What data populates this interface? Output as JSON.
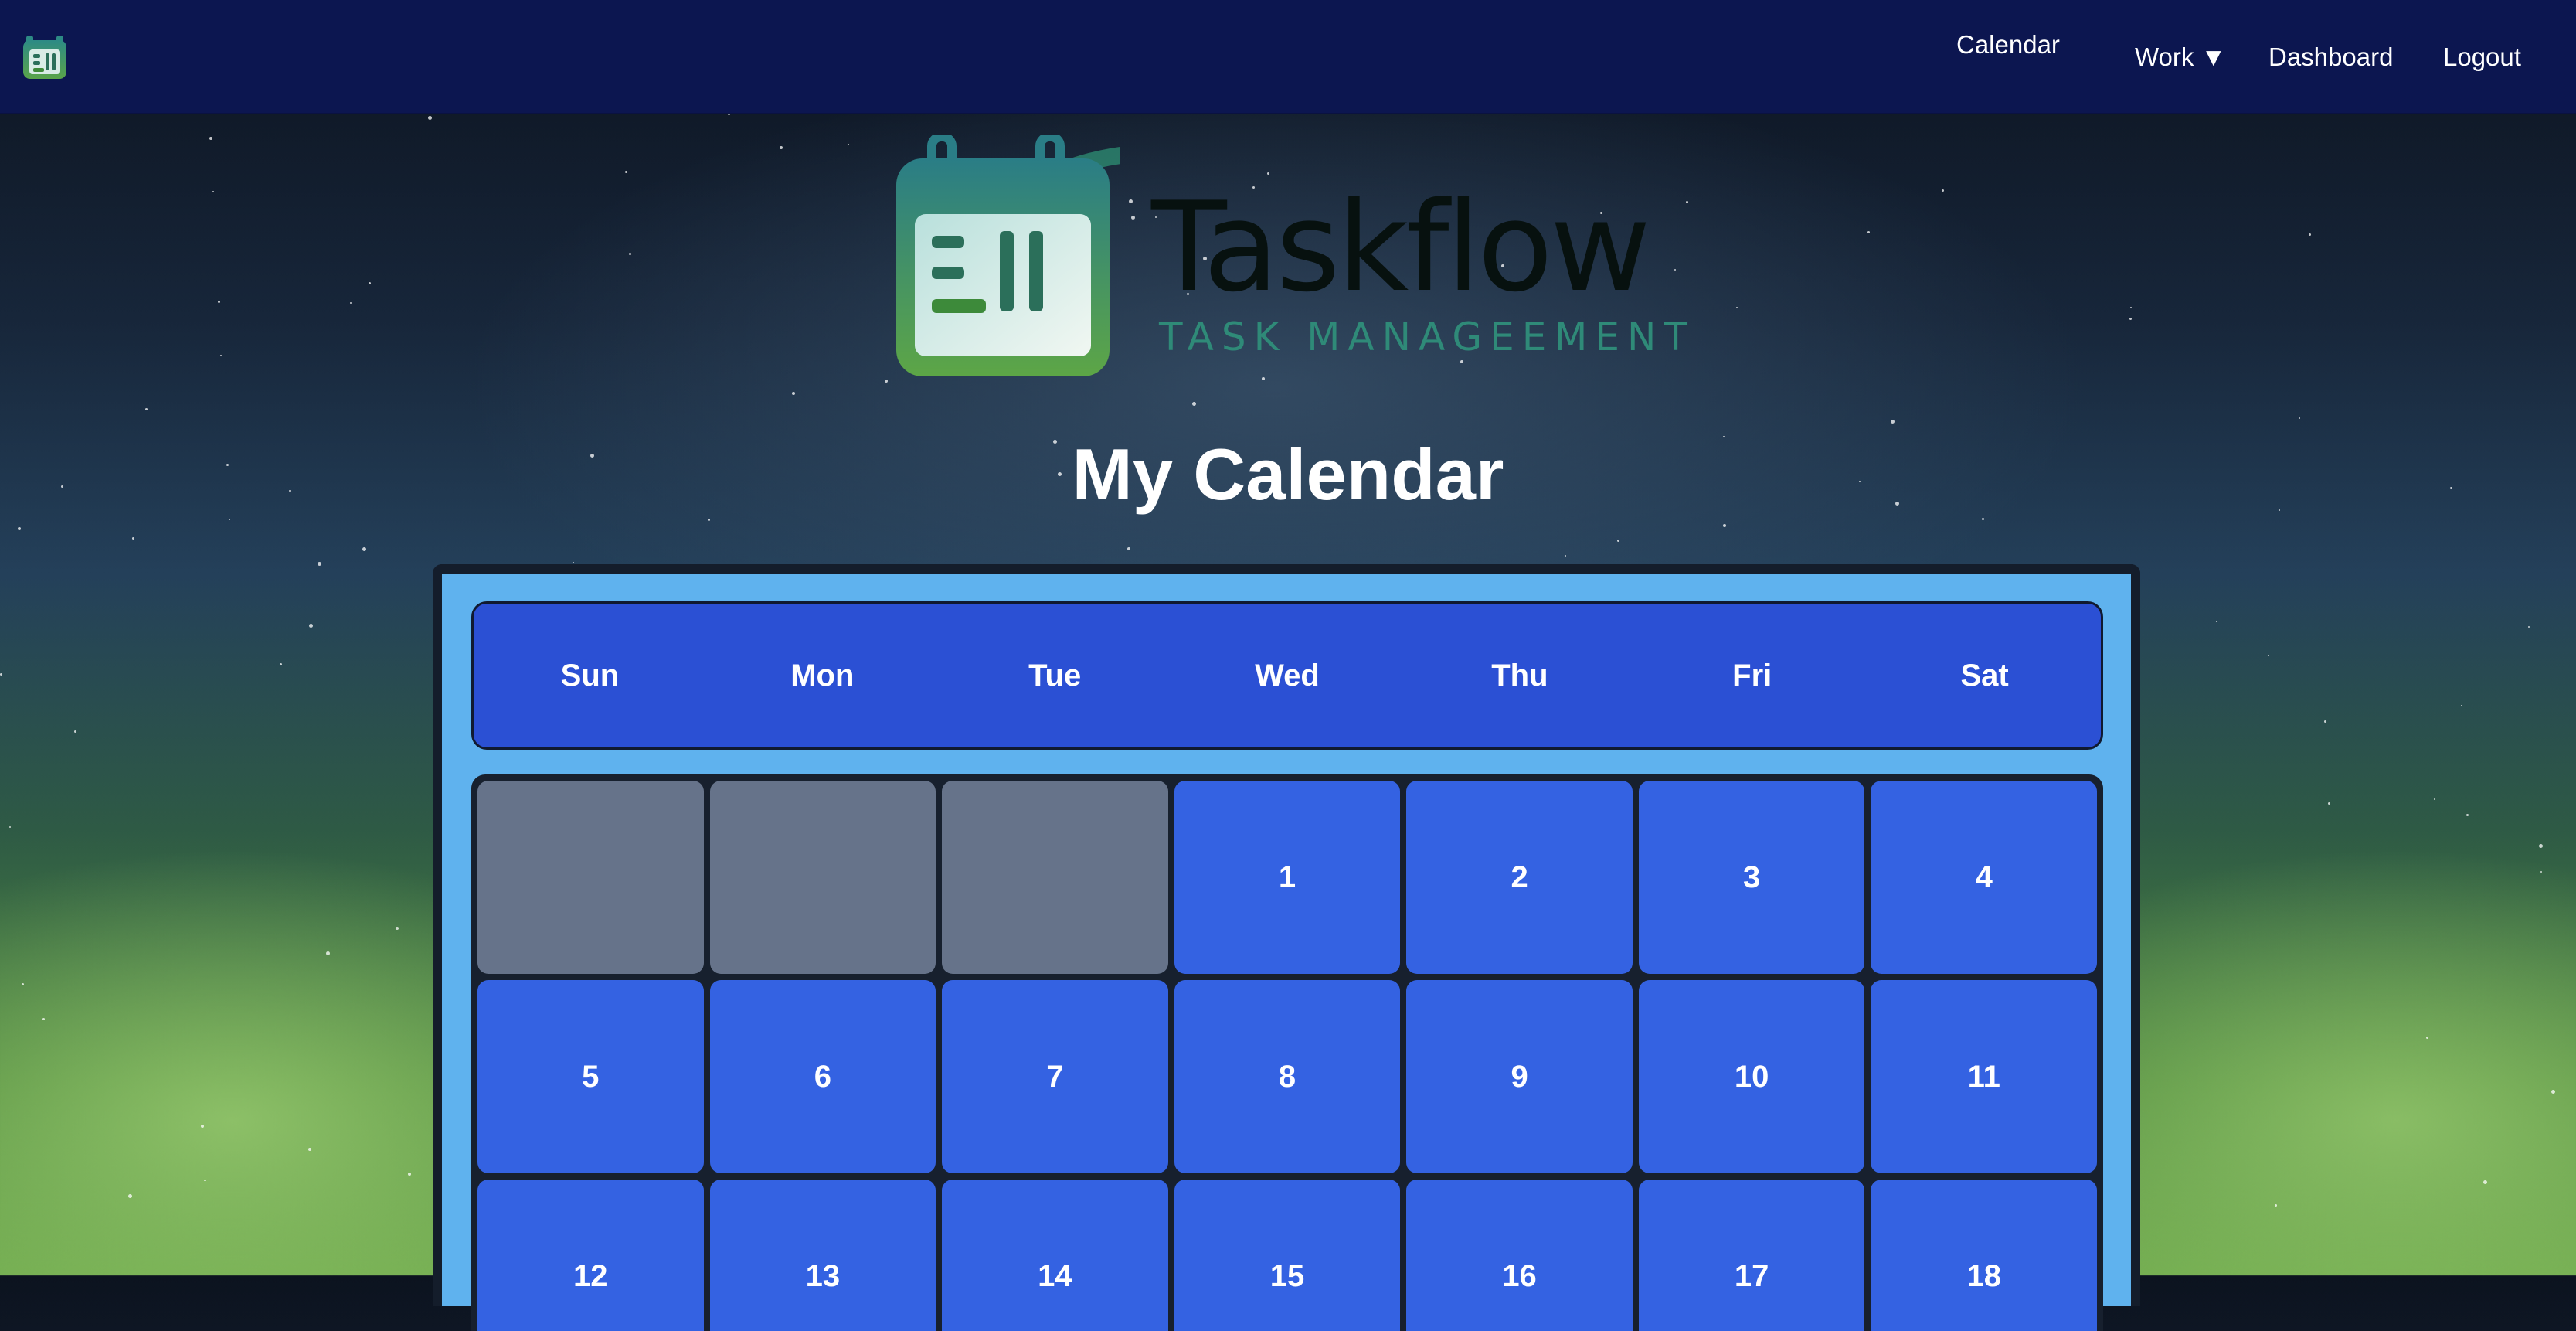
{
  "nav": {
    "calendar": "Calendar",
    "work": "Work ▼",
    "dashboard": "Dashboard",
    "logout": "Logout"
  },
  "brand": {
    "name": "Taskflow",
    "tagline": "TASK MANAGEEMENT"
  },
  "page": {
    "title": "My Calendar"
  },
  "calendar": {
    "weekdays": [
      "Sun",
      "Mon",
      "Tue",
      "Wed",
      "Thu",
      "Fri",
      "Sat"
    ],
    "leading_empty_days": 3,
    "days": [
      "1",
      "2",
      "3",
      "4",
      "5",
      "6",
      "7",
      "8",
      "9",
      "10",
      "11",
      "12",
      "13",
      "14",
      "15",
      "16",
      "17",
      "18"
    ]
  },
  "colors": {
    "navbar": "#0c1650",
    "calendar_frame": "#5fb2ee",
    "weekday_bar": "#2b50d4",
    "day_cell": "#3462e2",
    "empty_cell": "#66738a",
    "brand_accent": "#2f8a78"
  },
  "icons": {
    "nav_logo": "calendar-logo-icon",
    "brand_logo": "calendar-logo-icon"
  }
}
